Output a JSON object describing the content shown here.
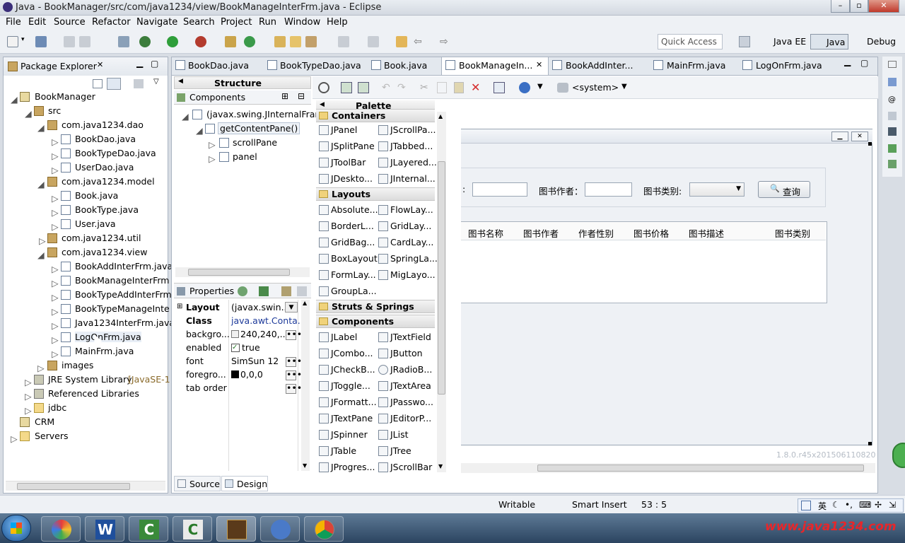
{
  "window": {
    "title": "Java - BookManager/src/com/java1234/view/BookManageInterFrm.java - Eclipse"
  },
  "menu": [
    "File",
    "Edit",
    "Source",
    "Refactor",
    "Navigate",
    "Search",
    "Project",
    "Run",
    "Window",
    "Help"
  ],
  "quick_access": "Quick Access",
  "perspectives": [
    "Java EE",
    "Java",
    "Debug"
  ],
  "package_explorer": {
    "title": "Package Explorer",
    "items": [
      {
        "label": "BookManager",
        "icon": "project-icon"
      },
      {
        "label": "src",
        "icon": "source-folder-icon"
      },
      {
        "label": "com.java1234.dao",
        "icon": "package-icon"
      },
      {
        "label": "BookDao.java",
        "icon": "java-file-icon"
      },
      {
        "label": "BookTypeDao.java",
        "icon": "java-file-icon"
      },
      {
        "label": "UserDao.java",
        "icon": "java-file-icon"
      },
      {
        "label": "com.java1234.model",
        "icon": "package-icon"
      },
      {
        "label": "Book.java",
        "icon": "java-file-icon"
      },
      {
        "label": "BookType.java",
        "icon": "java-file-icon"
      },
      {
        "label": "User.java",
        "icon": "java-file-icon"
      },
      {
        "label": "com.java1234.util",
        "icon": "package-icon"
      },
      {
        "label": "com.java1234.view",
        "icon": "package-icon"
      },
      {
        "label": "BookAddInterFrm.java",
        "icon": "java-file-icon"
      },
      {
        "label": "BookManageInterFrm",
        "icon": "java-file-icon"
      },
      {
        "label": "BookTypeAddInterFrm",
        "icon": "java-file-icon"
      },
      {
        "label": "BookTypeManageInte",
        "icon": "java-file-icon"
      },
      {
        "label": "Java1234InterFrm.java",
        "icon": "java-file-icon"
      },
      {
        "label": "LogOnFrm.java",
        "icon": "java-file-icon"
      },
      {
        "label": "MainFrm.java",
        "icon": "java-file-icon"
      },
      {
        "label": "images",
        "icon": "package-icon"
      },
      {
        "label": "JRE System Library",
        "icon": "library-icon"
      },
      {
        "label": "Referenced Libraries",
        "icon": "library-icon"
      },
      {
        "label": "jdbc",
        "icon": "folder-icon"
      },
      {
        "label": "CRM",
        "icon": "project-icon"
      },
      {
        "label": "Servers",
        "icon": "folder-icon"
      }
    ],
    "jre_suffix": "[JavaSE-1"
  },
  "editor_tabs": [
    "BookDao.java",
    "BookTypeDao.java",
    "Book.java",
    "BookManageIn...",
    "BookAddInter...",
    "MainFrm.java",
    "LogOnFrm.java"
  ],
  "structure": {
    "title": "Structure",
    "components_label": "Components",
    "tree": [
      "(javax.swing.JInternalFram",
      "getContentPane()",
      "scrollPane",
      "panel"
    ]
  },
  "properties": {
    "title": "Properties",
    "rows": [
      {
        "name": "Layout",
        "value": "(javax.swin..."
      },
      {
        "name": "Class",
        "value": "java.awt.Conta..."
      },
      {
        "name": "backgro...",
        "value": "240,240,..."
      },
      {
        "name": "enabled",
        "value": "true"
      },
      {
        "name": "font",
        "value": "SimSun 12"
      },
      {
        "name": "foregro...",
        "value": "0,0,0"
      },
      {
        "name": "tab order",
        "value": ""
      }
    ]
  },
  "palette": {
    "title": "Palette",
    "sections": {
      "containers": "Containers",
      "layouts": "Layouts",
      "struts": "Struts & Springs",
      "components": "Components"
    },
    "containers": [
      "JPanel",
      "JScrollPa...",
      "JSplitPane",
      "JTabbed...",
      "JToolBar",
      "JLayered...",
      "JDeskto...",
      "JInternal..."
    ],
    "layouts": [
      "Absolute...",
      "FlowLay...",
      "BorderL...",
      "GridLay...",
      "GridBag...",
      "CardLay...",
      "BoxLayout",
      "SpringLa...",
      "FormLay...",
      "MigLayo...",
      "GroupLa..."
    ],
    "components": [
      "JLabel",
      "JTextField",
      "JCombo...",
      "JButton",
      "JCheckB...",
      "JRadioB...",
      "JToggle...",
      "JTextArea",
      "JFormatt...",
      "JPasswo...",
      "JTextPane",
      "JEditorP...",
      "JSpinner",
      "JList",
      "JTable",
      "JTree",
      "JProgres...",
      "JScrollBar"
    ]
  },
  "toolbar2": {
    "system_label": "<system>"
  },
  "form": {
    "colon": ":",
    "author_label": "图书作者：",
    "type_label": "图书类别:",
    "search_button": "查询",
    "columns": [
      "图书名称",
      "图书作者",
      "作者性别",
      "图书价格",
      "图书描述",
      "图书类别"
    ]
  },
  "version_text": "1.8.0.r45x201506110820",
  "bottom_tabs": [
    "Source",
    "Design"
  ],
  "status": {
    "writable": "Writable",
    "insert": "Smart Insert",
    "position": "53 : 5"
  },
  "tray": {
    "lang": "英"
  },
  "watermark": "www.java1234.com"
}
